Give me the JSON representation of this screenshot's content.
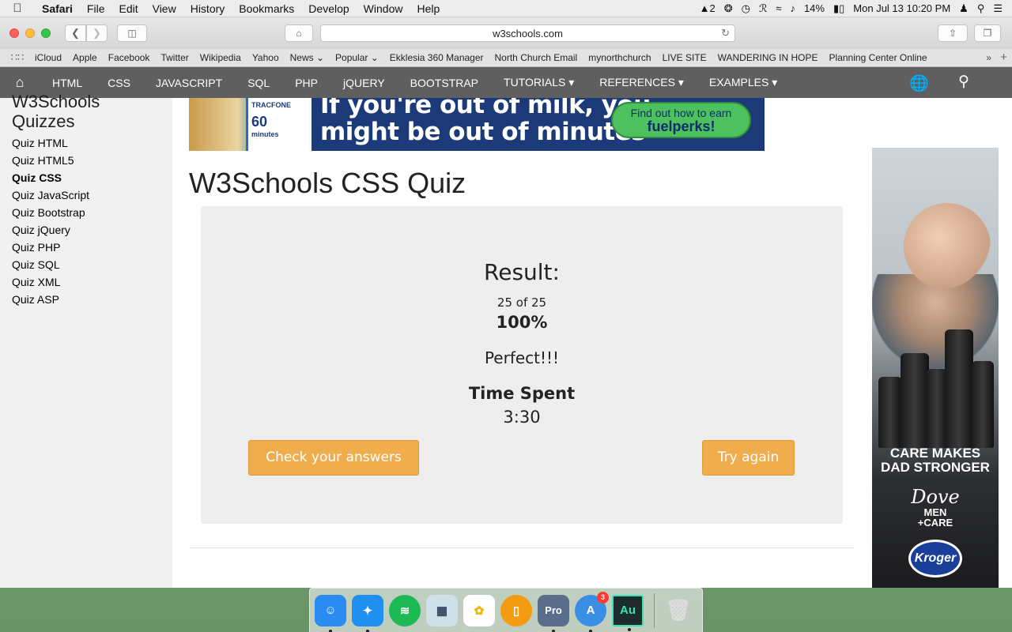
{
  "menubar": {
    "app": "Safari",
    "items": [
      "File",
      "Edit",
      "View",
      "History",
      "Bookmarks",
      "Develop",
      "Window",
      "Help"
    ],
    "adobe_count": "2",
    "battery": "14%",
    "datetime": "Mon Jul 13  10:20 PM"
  },
  "browser": {
    "url": "w3schools.com",
    "bookmarks": [
      "iCloud",
      "Apple",
      "Facebook",
      "Twitter",
      "Wikipedia",
      "Yahoo",
      "News ⌄",
      "Popular ⌄",
      "Ekklesia 360 Manager",
      "North Church Email",
      "mynorthchurch",
      "LIVE SITE",
      "WANDERING IN HOPE",
      "Planning Center Online"
    ]
  },
  "w3nav": {
    "items": [
      "HTML",
      "CSS",
      "JAVASCRIPT",
      "SQL",
      "PHP",
      "jQUERY",
      "BOOTSTRAP",
      "TUTORIALS ▾",
      "REFERENCES ▾",
      "EXAMPLES ▾"
    ]
  },
  "sidebar": {
    "heading_line1": "W3Schools",
    "heading_line2": "Quizzes",
    "items": [
      "Quiz HTML",
      "Quiz HTML5",
      "Quiz CSS",
      "Quiz JavaScript",
      "Quiz Bootstrap",
      "Quiz jQuery",
      "Quiz PHP",
      "Quiz SQL",
      "Quiz XML",
      "Quiz ASP"
    ],
    "active": "Quiz CSS"
  },
  "banner": {
    "brand": "TRACFONE",
    "minutes": "60",
    "minutes_label": "minutes",
    "headline_line1": "If you're out of milk, you",
    "headline_line2": "might be out of minutes",
    "cta_line1": "Find out how to earn",
    "cta_line2": "fuelperks!"
  },
  "main": {
    "title": "W3Schools CSS Quiz",
    "result_label": "Result:",
    "score": "25 of 25",
    "percent": "100%",
    "verdict": "Perfect!!!",
    "time_label": "Time Spent",
    "time_value": "3:30",
    "check_button": "Check your answers",
    "again_button": "Try again"
  },
  "side_ad": {
    "tagline_line1": "CARE MAKES",
    "tagline_line2": "DAD STRONGER",
    "brand": "Dove",
    "brand_sub_line1": "MEN",
    "brand_sub_line2": "+CARE",
    "retailer": "Kroger"
  },
  "dock": {
    "apps": [
      {
        "name": "Finder",
        "color": "#2a8cf0",
        "glyph": "☺"
      },
      {
        "name": "Safari",
        "color": "#1f8ff0",
        "glyph": "✦"
      },
      {
        "name": "Spotify",
        "color": "#1db954",
        "glyph": "≋"
      },
      {
        "name": "Preview",
        "color": "#cfe0ea",
        "glyph": "▦"
      },
      {
        "name": "Photos",
        "color": "#f4b400",
        "glyph": "✿"
      },
      {
        "name": "iBooks",
        "color": "#f39c12",
        "glyph": "▯"
      },
      {
        "name": "ProPresenter",
        "color": "#5a6e8c",
        "glyph": "Pro"
      },
      {
        "name": "App Store",
        "color": "#3a8ee6",
        "glyph": "A",
        "badge": "3"
      },
      {
        "name": "Adobe Audition",
        "color": "#1c2b2b",
        "glyph": "Au"
      }
    ],
    "trash_glyph": "🗑"
  }
}
